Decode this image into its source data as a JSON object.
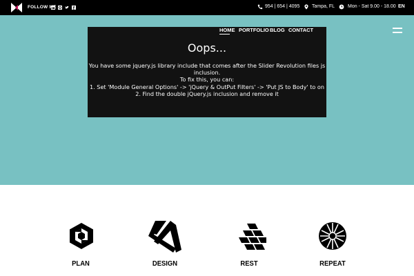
{
  "topbar": {
    "follow_label": "FOLLOW ME",
    "socials": [
      "linkedin-icon",
      "pinterest-icon",
      "twitter-icon",
      "facebook-icon"
    ],
    "phone": "954 | 654 | 4095",
    "location": "Tampa, FL",
    "hours": "Mon - Sat 9.00 - 18.00",
    "language": "EN"
  },
  "nav": {
    "items": [
      "HOME",
      "PORTFOLIO",
      "BLOG",
      "CONTACT"
    ],
    "active": "HOME"
  },
  "error": {
    "title": "Oops...",
    "lines": [
      "You have some jquery.js library include that comes after the Slider Revolution files js",
      "inclusion.",
      "To fix this, you can:",
      "1. Set 'Module General Options' -> 'jQuery & OutPut Filters' -> 'Put JS to Body' to on",
      "2. Find the double jQuery.js inclusion and remove it"
    ]
  },
  "features": [
    "PLAN",
    "DESIGN",
    "REST",
    "REPEAT"
  ],
  "colors": {
    "topbar": "#000000",
    "hero": "#78c1c2",
    "error_box": "#121212",
    "logo_accent": "#c2185b"
  }
}
